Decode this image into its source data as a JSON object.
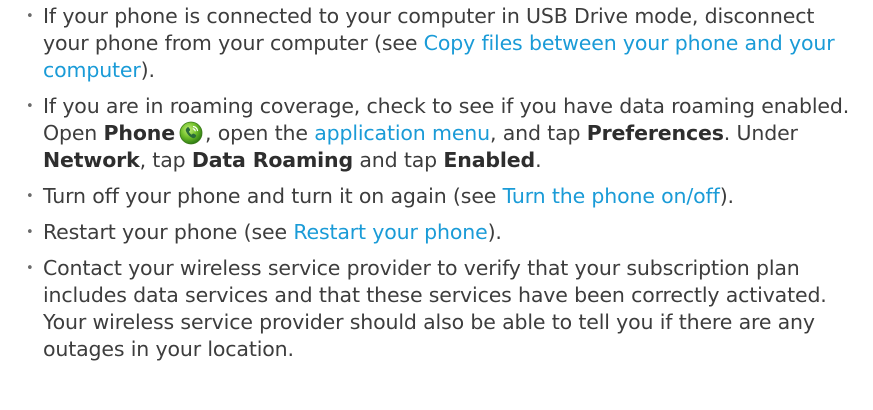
{
  "bullets": [
    {
      "t1": "If your phone is connected to your computer in USB Drive mode, disconnect your phone from your computer (see ",
      "link1": "Copy files between your phone and your computer",
      "t2": ")."
    },
    {
      "t1": "If you are in roaming coverage, check to see if you have data roaming enabled. Open ",
      "b1": "Phone",
      "icon": "phone-app-icon",
      "t2": ", open the ",
      "link1": "application menu",
      "t3": ", and tap ",
      "b2": "Preferences",
      "t4": ". Under ",
      "b3": "Network",
      "t5": ", tap ",
      "b4": "Data Roaming",
      "t6": " and tap ",
      "b5": "Enabled",
      "t7": "."
    },
    {
      "t1": "Turn off your phone and turn it on again (see ",
      "link1": "Turn the phone on/off",
      "t2": ")."
    },
    {
      "t1": "Restart your phone (see ",
      "link1": "Restart your phone",
      "t2": ")."
    },
    {
      "t1": "Contact your wireless service provider to verify that your subscription plan includes data services and that these services have been correctly activated. Your wireless service provider should also be able to tell you if there are any outages in your location."
    }
  ],
  "bullet_glyph": "•",
  "colors": {
    "text": "#3d3d3d",
    "link": "#1a9bd7",
    "bold": "#2e2e2e"
  }
}
